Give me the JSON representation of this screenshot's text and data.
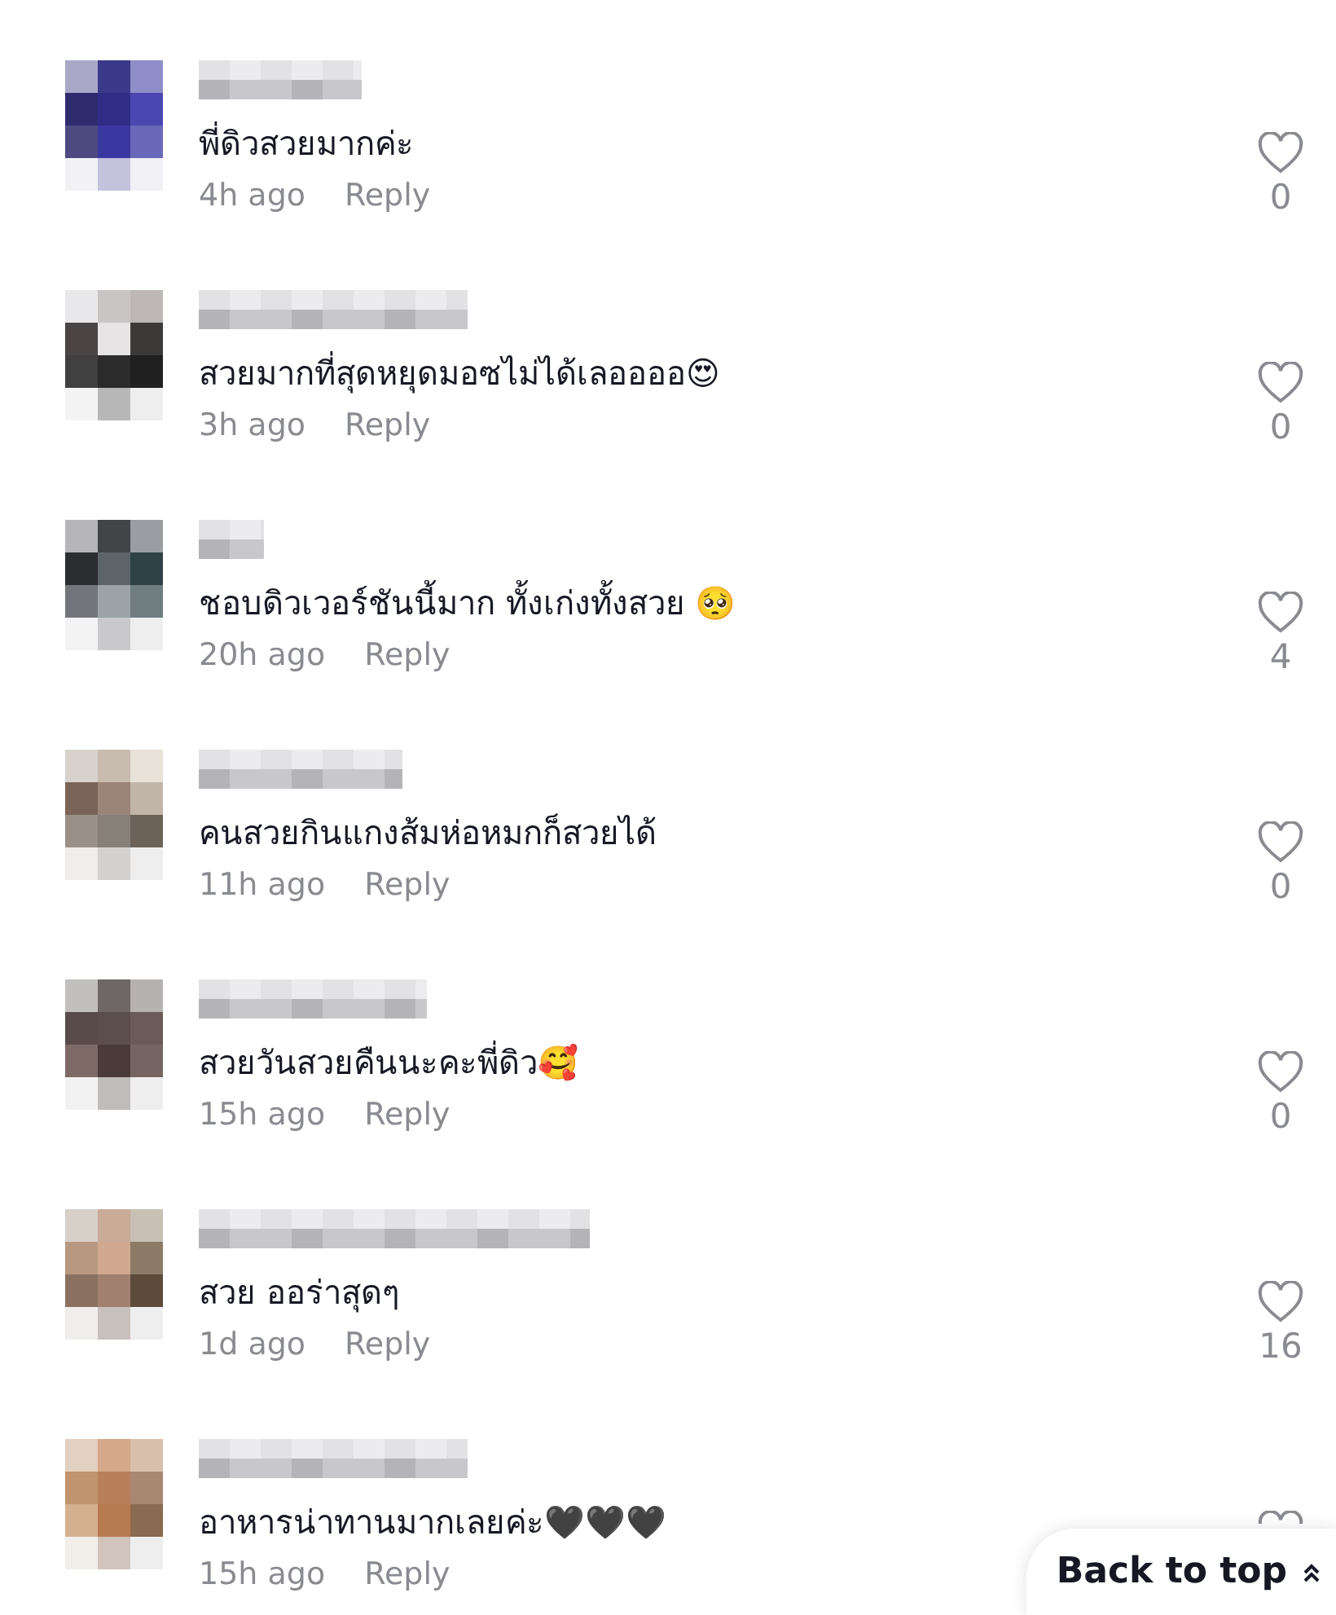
{
  "comments": [
    {
      "text": "พี่ดิวสวยมากค่ะ",
      "time": "4h ago",
      "reply": "Reply",
      "likes": "0"
    },
    {
      "text": "สวยมากที่สุดหยุดมอซไม่ได้เลออออ😍",
      "time": "3h ago",
      "reply": "Reply",
      "likes": "0"
    },
    {
      "text": "ชอบดิวเวอร์ชันนี้มาก ทั้งเก่งทั้งสวย 🥺",
      "time": "20h ago",
      "reply": "Reply",
      "likes": "4"
    },
    {
      "text": "คนสวยกินแกงส้มห่อหมกก็สวยได้",
      "time": "11h ago",
      "reply": "Reply",
      "likes": "0"
    },
    {
      "text": "สวยวันสวยคืนนะคะพี่ดิว🥰",
      "time": "15h ago",
      "reply": "Reply",
      "likes": "0"
    },
    {
      "text": "สวย ออร่าสุดๆ",
      "time": "1d ago",
      "reply": "Reply",
      "likes": "16"
    },
    {
      "text": "อาหารน่าทานมากเลยค่ะ🖤🖤🖤",
      "time": "15h ago",
      "reply": "Reply"
    }
  ],
  "back_to_top": {
    "label": "Back to top"
  }
}
